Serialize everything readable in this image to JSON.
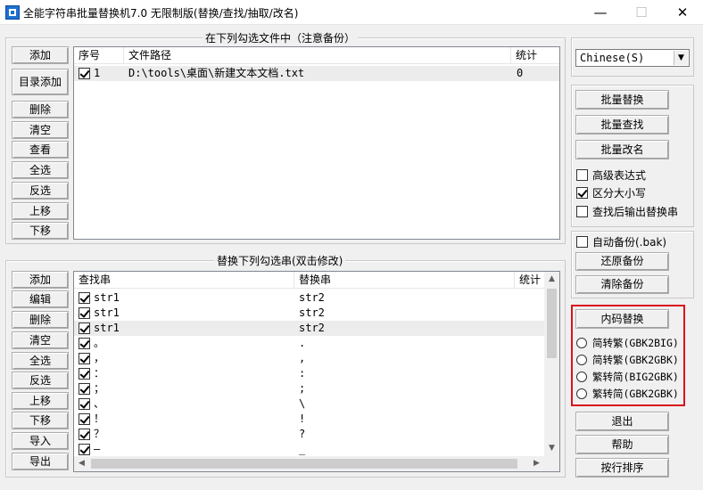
{
  "window": {
    "title": "全能字符串批量替换机7.0 无限制版(替换/查找/抽取/改名)",
    "minimize": "—",
    "maximize": "☐",
    "close": "✕"
  },
  "file_panel": {
    "group_title": "在下列勾选文件中（注意备份）",
    "buttons": [
      "添加",
      "目录添加",
      "删除",
      "清空",
      "查看",
      "全选",
      "反选",
      "上移",
      "下移"
    ],
    "columns": [
      "序号",
      "文件路径",
      "统计"
    ],
    "rows": [
      {
        "checked": true,
        "index": "1",
        "path": "D:\\tools\\桌面\\新建文本文档.txt",
        "count": "0"
      }
    ]
  },
  "replace_panel": {
    "group_title": "替换下列勾选串(双击修改)",
    "buttons": [
      "添加",
      "编辑",
      "删除",
      "清空",
      "全选",
      "反选",
      "上移",
      "下移",
      "导入",
      "导出"
    ],
    "columns": [
      "查找串",
      "替换串",
      "统计"
    ],
    "rows": [
      {
        "checked": true,
        "find": "str1",
        "replace": "str2"
      },
      {
        "checked": true,
        "find": "str1",
        "replace": "str2"
      },
      {
        "checked": true,
        "find": "str1",
        "replace": "str2"
      },
      {
        "checked": true,
        "find": "。",
        "replace": "."
      },
      {
        "checked": true,
        "find": "，",
        "replace": ","
      },
      {
        "checked": true,
        "find": "：",
        "replace": ":"
      },
      {
        "checked": true,
        "find": "；",
        "replace": ";"
      },
      {
        "checked": true,
        "find": "、",
        "replace": "\\"
      },
      {
        "checked": true,
        "find": "！",
        "replace": "!"
      },
      {
        "checked": true,
        "find": "？",
        "replace": "?"
      },
      {
        "checked": true,
        "find": "—",
        "replace": "_"
      }
    ]
  },
  "right_panel": {
    "language": "Chinese(S)",
    "batch_replace": "批量替换",
    "batch_find": "批量查找",
    "batch_rename": "批量改名",
    "options": [
      {
        "label": "高级表达式",
        "checked": false
      },
      {
        "label": "区分大小写",
        "checked": true
      },
      {
        "label": "查找后输出替换串",
        "checked": false
      }
    ],
    "auto_backup": {
      "label": "自动备份(.bak)",
      "checked": false
    },
    "restore_backup": "还原备份",
    "clear_backup": "清除备份",
    "encoding_replace": "内码替换",
    "encoding_options": [
      "简转繁(GBK2BIG)",
      "简转繁(GBK2GBK)",
      "繁转简(BIG2GBK)",
      "繁转简(GBK2GBK)"
    ],
    "exit": "退出",
    "help": "帮助",
    "sort_lines": "按行排序"
  },
  "colors": {
    "highlight_border": "#d9141b"
  }
}
